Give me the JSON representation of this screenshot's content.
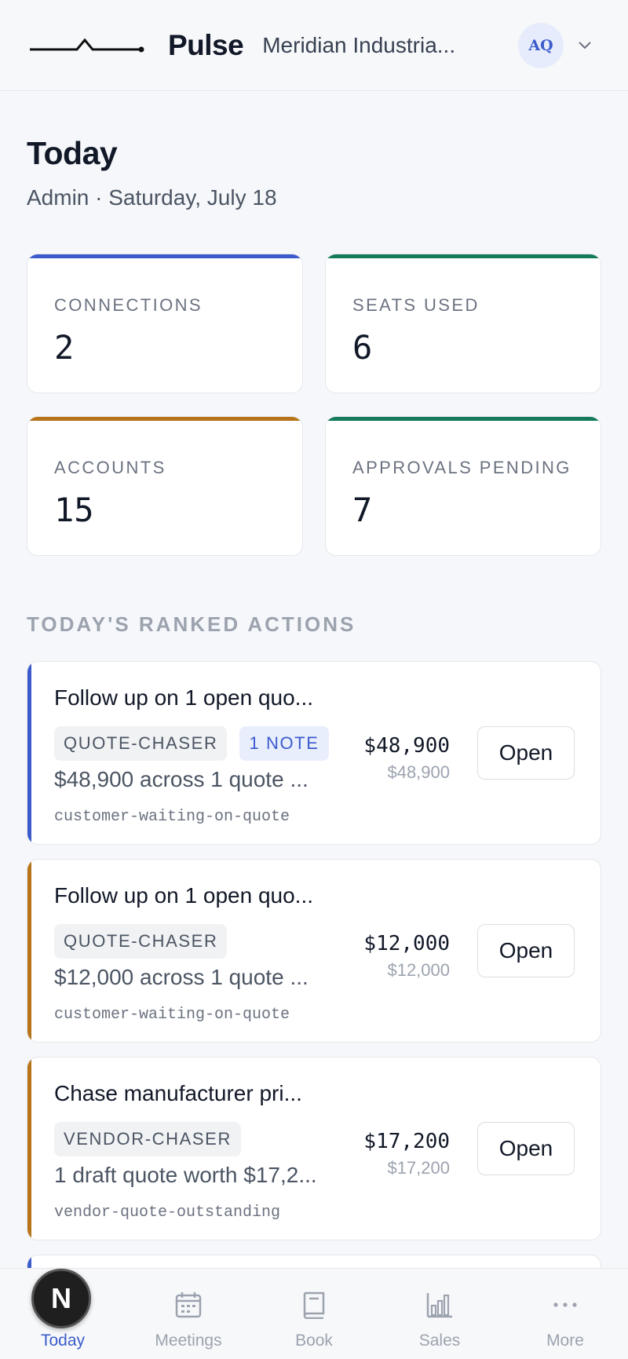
{
  "header": {
    "brand": "Pulse",
    "org": "Meridian Industria...",
    "avatar_initials": "AQ"
  },
  "page": {
    "title": "Today",
    "subtitle": "Admin · Saturday, July 18"
  },
  "stats": [
    {
      "label": "CONNECTIONS",
      "value": "2",
      "color": "#3b5bcc"
    },
    {
      "label": "SEATS USED",
      "value": "6",
      "color": "#137a5a"
    },
    {
      "label": "ACCOUNTS",
      "value": "15",
      "color": "#b8741a"
    },
    {
      "label": "APPROVALS PENDING",
      "value": "7",
      "color": "#137a5a"
    }
  ],
  "section_title": "TODAY'S RANKED ACTIONS",
  "actions": [
    {
      "title": "Follow up on 1 open quo...",
      "tag": "QUOTE-CHASER",
      "note": "1 NOTE",
      "desc": "$48,900 across 1 quote ...",
      "code": "customer-waiting-on-quote",
      "amount": "$48,900",
      "amount_sub": "$48,900",
      "button": "Open",
      "color": "#3b5bcc"
    },
    {
      "title": "Follow up on 1 open quo...",
      "tag": "QUOTE-CHASER",
      "desc": "$12,000 across 1 quote ...",
      "code": "customer-waiting-on-quote",
      "amount": "$12,000",
      "amount_sub": "$12,000",
      "button": "Open",
      "color": "#b8741a"
    },
    {
      "title": "Chase manufacturer pri...",
      "tag": "VENDOR-CHASER",
      "desc": "1 draft quote worth $17,2...",
      "code": "vendor-quote-outstanding",
      "amount": "$17,200",
      "amount_sub": "$17,200",
      "button": "Open",
      "color": "#b8741a"
    }
  ],
  "nav": [
    {
      "label": "Today",
      "icon": "home-icon",
      "active": true
    },
    {
      "label": "Meetings",
      "icon": "calendar-icon"
    },
    {
      "label": "Book",
      "icon": "book-icon"
    },
    {
      "label": "Sales",
      "icon": "bar-chart-icon"
    },
    {
      "label": "More",
      "icon": "more-icon"
    }
  ],
  "dev_badge": "N"
}
